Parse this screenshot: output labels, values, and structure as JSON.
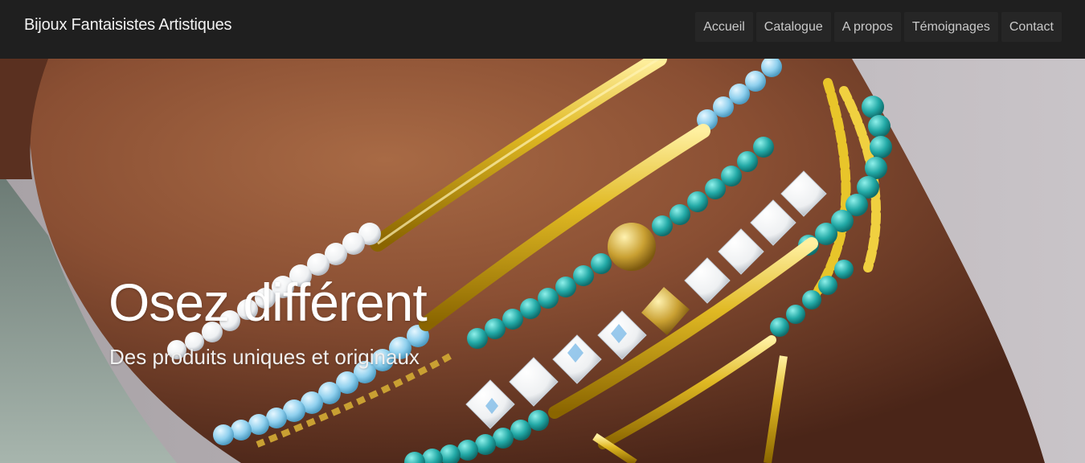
{
  "header": {
    "brand": "Bijoux Fantaisistes Artistiques",
    "nav": [
      "Accueil",
      "Catalogue",
      "A propos",
      "Témoignages",
      "Contact"
    ]
  },
  "hero": {
    "title": "Osez différent",
    "subtitle": "Des produits uniques et originaux",
    "image_description": "close-up of beaded bracelets in gold, turquoise and white on a wrist"
  },
  "colors": {
    "header_bg": "#1f1f1f",
    "nav_item_bg": "#262626",
    "gold": "#d8b21a",
    "turquoise": "#2fb3b0",
    "light_blue": "#8fd0ee",
    "skin": "#8a4f33"
  }
}
